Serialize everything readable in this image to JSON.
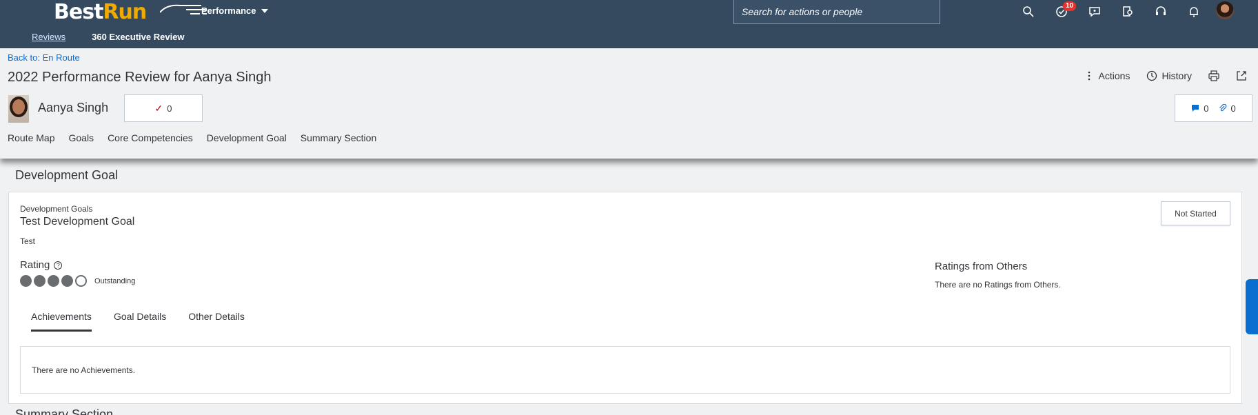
{
  "shell": {
    "logo_best": "Best",
    "logo_run": "Run",
    "module": "Performance",
    "search_placeholder": "Search for actions or people",
    "notification_badge": "10"
  },
  "subnav": {
    "items": [
      "Reviews",
      "360 Executive Review"
    ]
  },
  "header": {
    "back_link": "Back to: En Route",
    "title": "2022 Performance Review for Aanya Singh",
    "person_name": "Aanya Singh",
    "checks_count": "0",
    "comments_count": "0",
    "attachments_count": "0",
    "actions_label": "Actions",
    "history_label": "History",
    "anchors": [
      "Route Map",
      "Goals",
      "Core Competencies",
      "Development Goal",
      "Summary Section"
    ]
  },
  "section": {
    "title": "Development Goal",
    "card": {
      "category": "Development Goals",
      "goal_name": "Test Development Goal",
      "goal_desc": "Test",
      "status": "Not Started",
      "rating_label": "Rating",
      "rating_value": 4,
      "rating_max": 5,
      "rating_text": "Outstanding",
      "others_title": "Ratings from Others",
      "others_none": "There are no Ratings from Others.",
      "tabs": [
        "Achievements",
        "Goal Details",
        "Other Details"
      ],
      "tab_content": "There are no Achievements."
    }
  },
  "next_section_title": "Summary Section"
}
